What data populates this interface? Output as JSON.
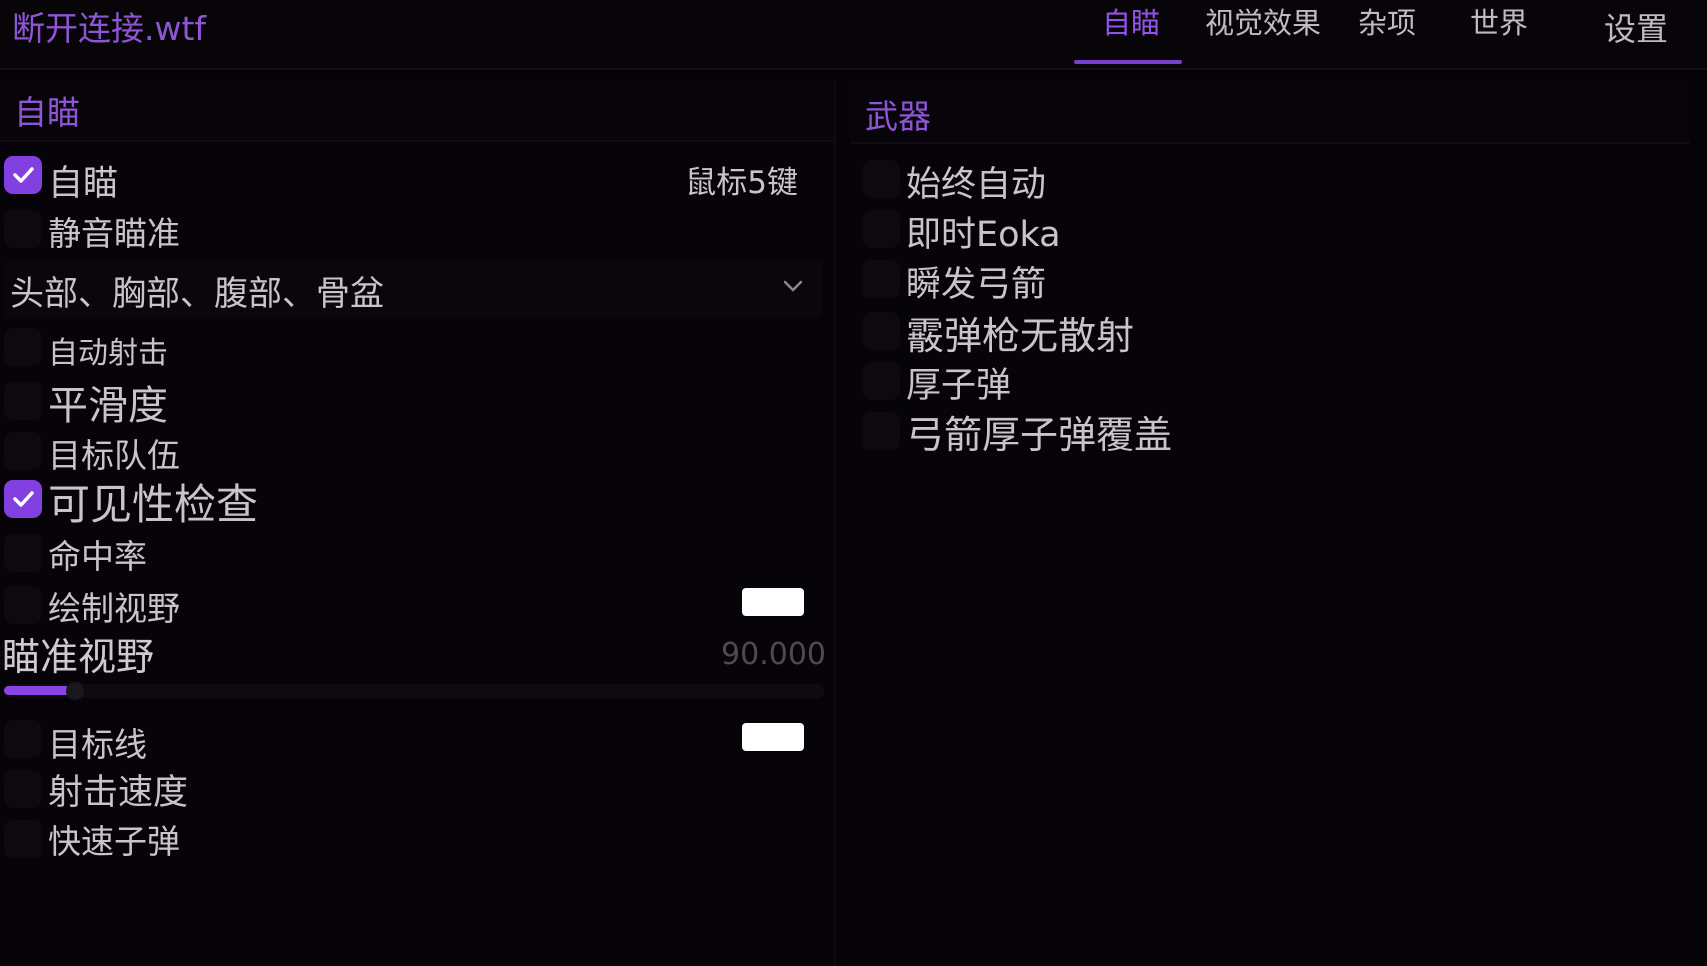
{
  "app": {
    "title": "断开连接.wtf",
    "accent_color": "#8340e0"
  },
  "tabs": [
    {
      "label": "自瞄",
      "active": true
    },
    {
      "label": "视觉效果",
      "active": false
    },
    {
      "label": "杂项",
      "active": false
    },
    {
      "label": "世界",
      "active": false
    },
    {
      "label": "设置",
      "active": false
    }
  ],
  "aim_panel": {
    "title": "自瞄",
    "aimbot": {
      "label": "自瞄",
      "checked": true,
      "keybind": "鼠标5键"
    },
    "silent_aim": {
      "label": "静音瞄准",
      "checked": false
    },
    "hitbox_select": {
      "value": "头部、胸部、腹部、骨盆",
      "icon": "chevron-down-icon"
    },
    "auto_shoot": {
      "label": "自动射击",
      "checked": false
    },
    "smoothness": {
      "label": "平滑度",
      "checked": false
    },
    "target_team": {
      "label": "目标队伍",
      "checked": false
    },
    "visibility_check": {
      "label": "可见性检查",
      "checked": true
    },
    "hit_chance": {
      "label": "命中率",
      "checked": false
    },
    "draw_fov": {
      "label": "绘制视野",
      "checked": false,
      "color": "#ffffff"
    },
    "aim_fov": {
      "label": "瞄准视野",
      "value": "90.000",
      "fill_fraction": 0.08
    },
    "target_line": {
      "label": "目标线",
      "checked": false,
      "color": "#ffffff"
    },
    "fire_rate": {
      "label": "射击速度",
      "checked": false
    },
    "fast_bullet": {
      "label": "快速子弹",
      "checked": false
    }
  },
  "weapon_panel": {
    "title": "武器",
    "items": [
      {
        "label": "始终自动",
        "checked": false
      },
      {
        "label": "即时Eoka",
        "checked": false
      },
      {
        "label": "瞬发弓箭",
        "checked": false
      },
      {
        "label": "霰弹枪无散射",
        "checked": false
      },
      {
        "label": "厚子弹",
        "checked": false
      },
      {
        "label": "弓箭厚子弹覆盖",
        "checked": false
      }
    ]
  }
}
